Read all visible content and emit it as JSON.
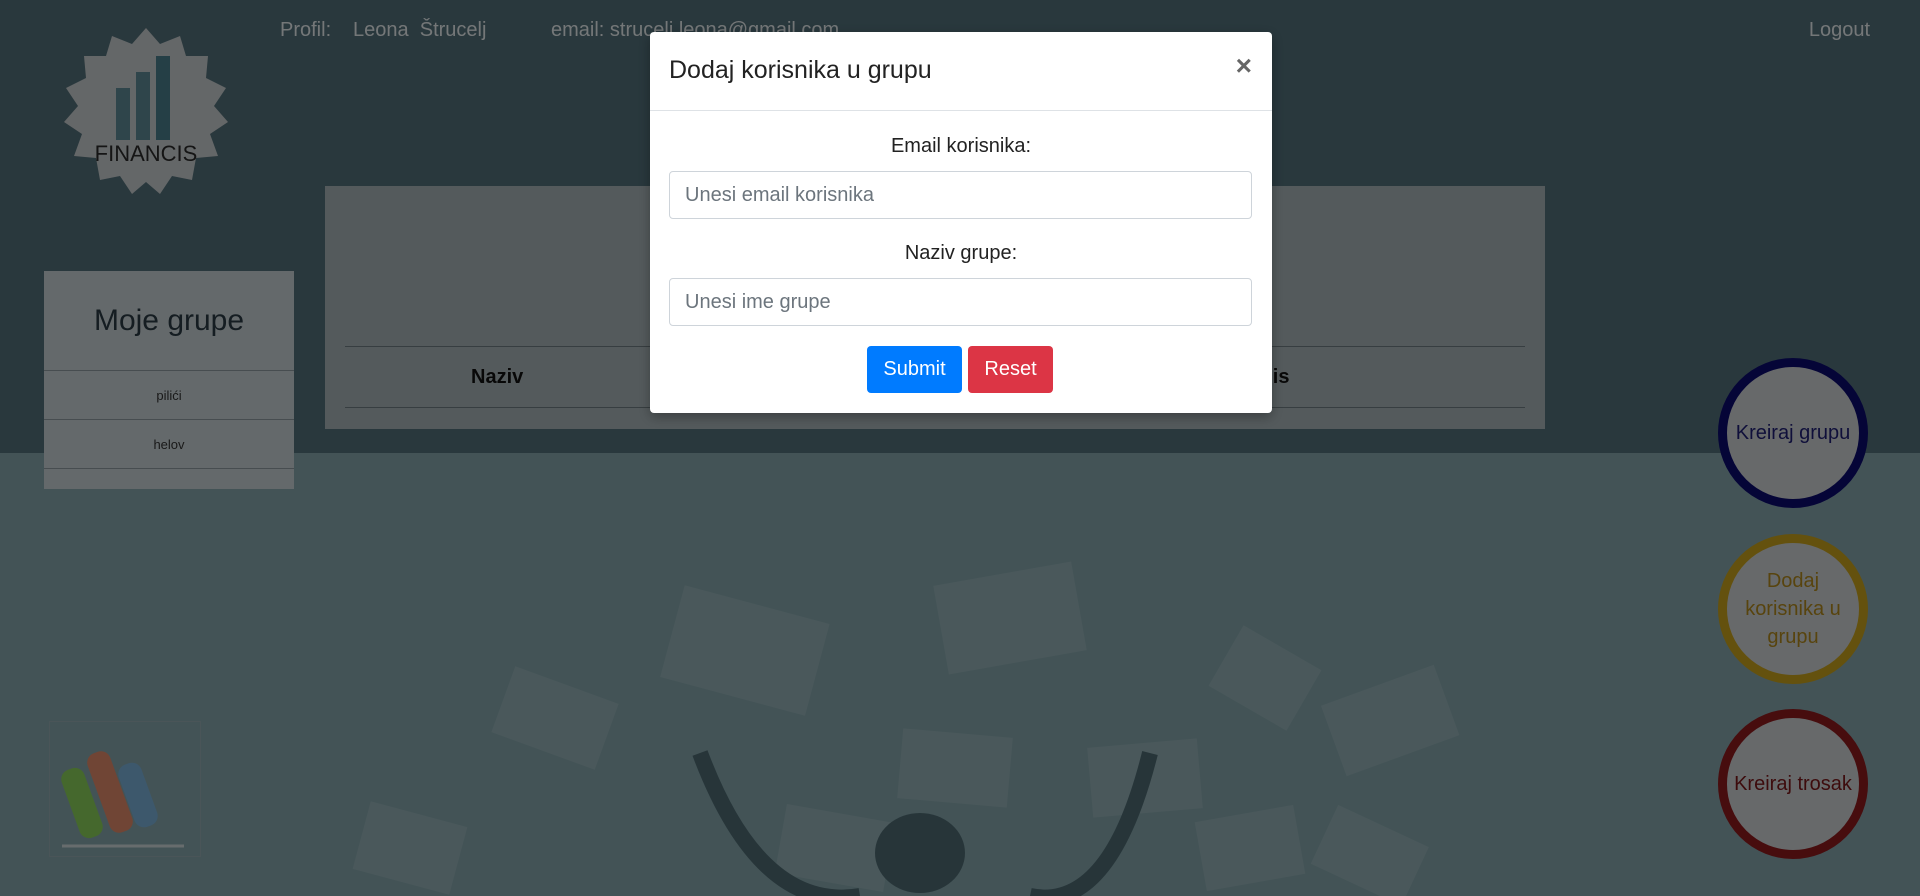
{
  "header": {
    "logo_text": "FINANCIS",
    "profile_label": "Profil:",
    "profile_name": "Leona  Štrucelj",
    "profile_email": "email: strucelj.leona@gmail.com",
    "logout_label": "Logout"
  },
  "sidebar": {
    "title": "Moje grupe",
    "items": [
      {
        "label": "pilići"
      },
      {
        "label": "helov"
      }
    ]
  },
  "main": {
    "columns": [
      "Naziv",
      "Opis"
    ]
  },
  "actions": {
    "create_group": "Kreiraj grupu",
    "add_user": "Dodaj korisnika u grupu",
    "create_expense": "Kreiraj trosak"
  },
  "modal": {
    "title": "Dodaj korisnika u grupu",
    "close_symbol": "×",
    "email_label": "Email korisnika:",
    "email_placeholder": "Unesi email korisnika",
    "group_label": "Naziv grupe:",
    "group_placeholder": "Unesi ime grupe",
    "submit_label": "Submit",
    "reset_label": "Reset"
  },
  "colors": {
    "submit": "#007bff",
    "reset": "#dc3545",
    "create_group_ring": "#0a0a6e",
    "add_user_ring": "#c9a21c",
    "create_expense_ring": "#8f1a1d"
  }
}
